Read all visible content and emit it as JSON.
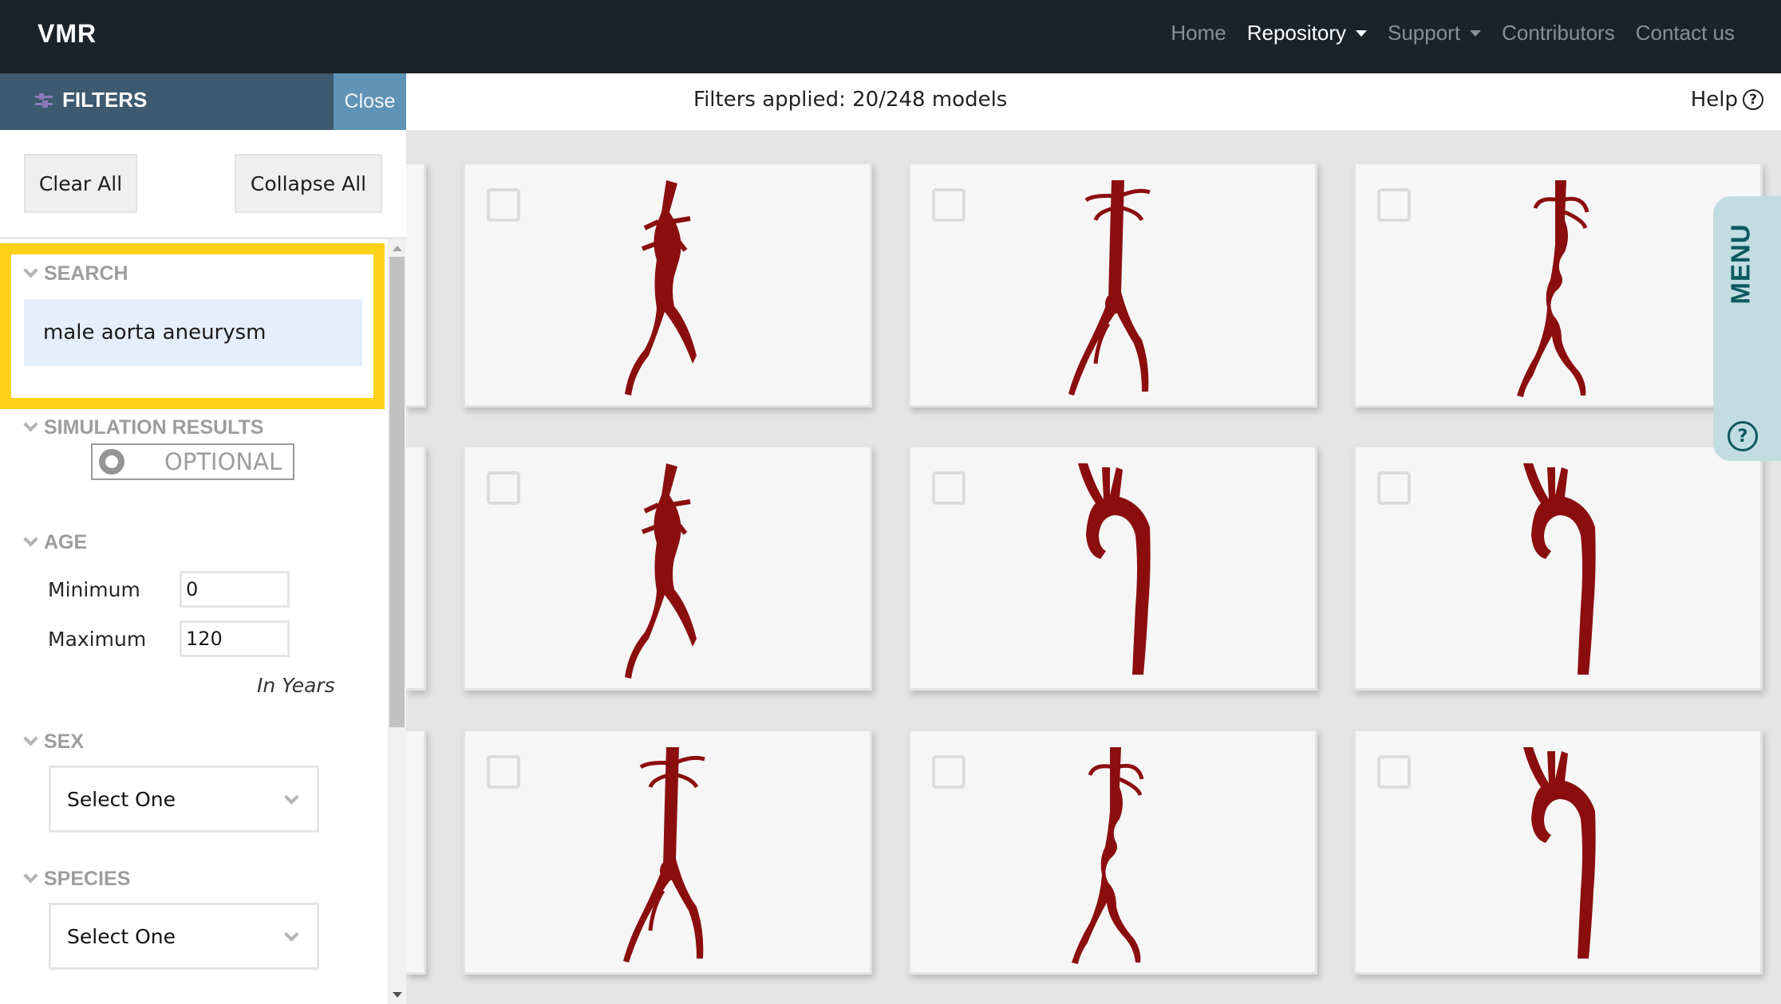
{
  "navbar": {
    "brand": "VMR",
    "links": [
      {
        "label": "Home",
        "active": false,
        "dropdown": false
      },
      {
        "label": "Repository",
        "active": true,
        "dropdown": true
      },
      {
        "label": "Support",
        "active": false,
        "dropdown": true
      },
      {
        "label": "Contributors",
        "active": false,
        "dropdown": false
      },
      {
        "label": "Contact us",
        "active": false,
        "dropdown": false
      }
    ]
  },
  "sidebar": {
    "title": "FILTERS",
    "icon": "sliders-icon",
    "close_label": "Close",
    "clear_all_label": "Clear All",
    "collapse_all_label": "Collapse All",
    "sections": {
      "search": {
        "title": "SEARCH",
        "value": "male aorta aneurysm"
      },
      "simulation": {
        "title": "SIMULATION RESULTS",
        "toggle_label": "OPTIONAL"
      },
      "age": {
        "title": "AGE",
        "min_label": "Minimum",
        "min_value": "0",
        "max_label": "Maximum",
        "max_value": "120",
        "unit_note": "In Years"
      },
      "sex": {
        "title": "SEX",
        "selected": "Select One"
      },
      "species": {
        "title": "SPECIES",
        "selected": "Select One"
      }
    }
  },
  "main": {
    "filters_applied": "Filters applied: 20/248 models",
    "help_label": "Help",
    "models": [
      {
        "type": "abdominal-aneurysm",
        "checked": false
      },
      {
        "type": "abdominal",
        "checked": false
      },
      {
        "type": "abdominal-tortuous",
        "checked": false
      },
      {
        "type": "abdominal-aneurysm",
        "checked": false
      },
      {
        "type": "thoracic-arch",
        "checked": false
      },
      {
        "type": "thoracic-arch",
        "checked": false
      },
      {
        "type": "abdominal",
        "checked": false
      },
      {
        "type": "abdominal-tortuous",
        "checked": false
      },
      {
        "type": "thoracic-arch",
        "checked": false
      }
    ]
  },
  "menu_tab": {
    "label": "MENU",
    "help_icon": "question-circle-icon"
  },
  "colors": {
    "navbar_bg": "#1b2228",
    "filters_bar": "#3d5a70",
    "close_button": "#5f93b6",
    "highlight": "#fcd116",
    "search_bg": "#e5eefb",
    "vessel": "#8b0e0e",
    "menu_tab": "#c2dde2",
    "menu_text": "#0b5a5e"
  }
}
